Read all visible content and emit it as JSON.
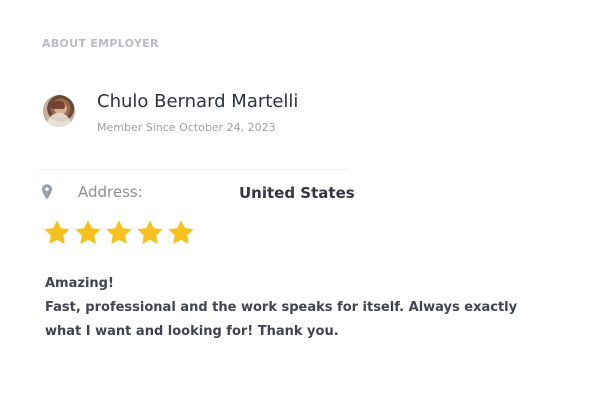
{
  "section": {
    "title": "ABOUT EMPLOYER"
  },
  "employer": {
    "name": "Chulo Bernard Martelli",
    "member_since": "Member Since October 24, 2023",
    "avatar_icon": "avatar-photo"
  },
  "address": {
    "icon": "location-pin-icon",
    "label": "Address:",
    "value": "United States"
  },
  "rating": {
    "stars": 5,
    "max": 5,
    "color": "#f6c11f",
    "icon": "star-icon"
  },
  "review": {
    "title": "Amazing!",
    "text": "Fast, professional and the work speaks for itself. Always exactly what I want and looking for! Thank you."
  }
}
